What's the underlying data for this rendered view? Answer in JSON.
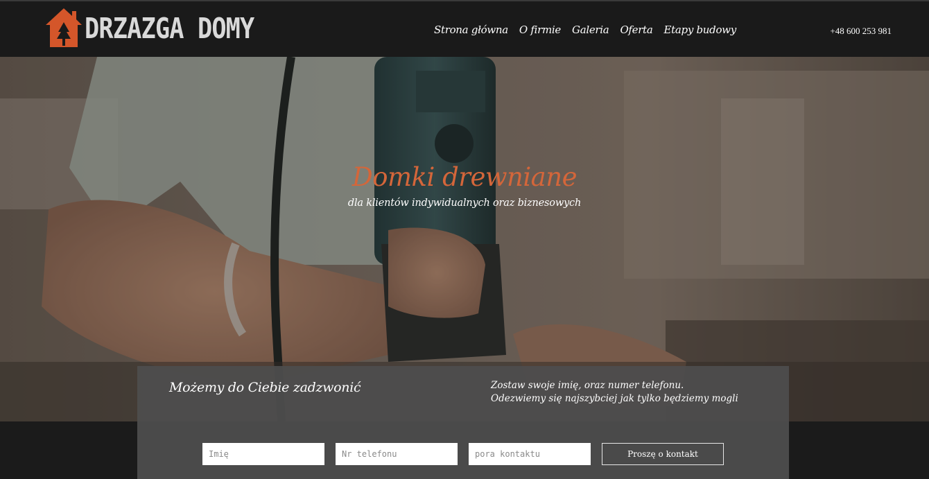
{
  "header": {
    "logo_text": "DRZAZGA DOMY",
    "nav": [
      {
        "label": "Strona główna"
      },
      {
        "label": "O firmie"
      },
      {
        "label": "Galeria"
      },
      {
        "label": "Oferta"
      },
      {
        "label": "Etapy budowy"
      }
    ],
    "phone": "+48 600 253 981"
  },
  "hero": {
    "title": "Domki drewniane",
    "subtitle": "dla klientów indywidualnych oraz biznesowych"
  },
  "contact": {
    "heading": "Możemy do Ciebie zadzwonić",
    "info_line1": "Zostaw swoje imię, oraz numer telefonu.",
    "info_line2": "Odezwiemy się najszybciej jak tylko będziemy mogli",
    "name_placeholder": "Imię",
    "phone_placeholder": "Nr telefonu",
    "time_placeholder": "pora kontaktu",
    "submit_label": "Proszę o kontakt"
  },
  "colors": {
    "accent": "#d4663a",
    "header_bg": "#1a1a1a",
    "panel_bg": "#4e4e4e"
  }
}
